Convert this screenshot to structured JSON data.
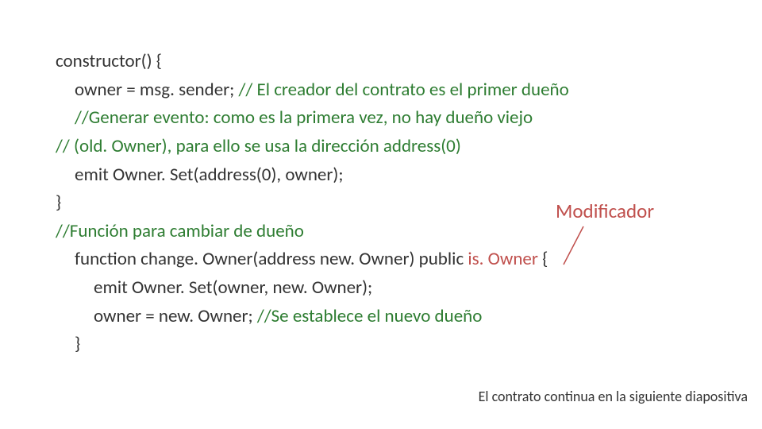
{
  "code": {
    "l1": "constructor() {",
    "l2a": "owner = msg. sender; ",
    "l2b": "// El creador del contrato es el primer dueño",
    "l3": "//Generar evento: como es la primera vez, no hay dueño viejo",
    "l4": "// (old. Owner), para ello se usa la dirección address(0)",
    "l5": "emit Owner. Set(address(0), owner);",
    "l6": "}",
    "l7": "//Función para cambiar de dueño",
    "l8a": "function change. Owner(address new. Owner) public ",
    "l8b": "is. Owner",
    "l8c": " {",
    "l9": "emit Owner. Set(owner, new. Owner);",
    "l10a": "owner = new. Owner; ",
    "l10b": "//Se establece el nuevo dueño",
    "l11": "}"
  },
  "labels": {
    "modificador": "Modificador",
    "footnote": "El contrato continua en la siguiente diapositiva"
  },
  "colors": {
    "comment": "#2E7D32",
    "accent": "#C0504D"
  }
}
